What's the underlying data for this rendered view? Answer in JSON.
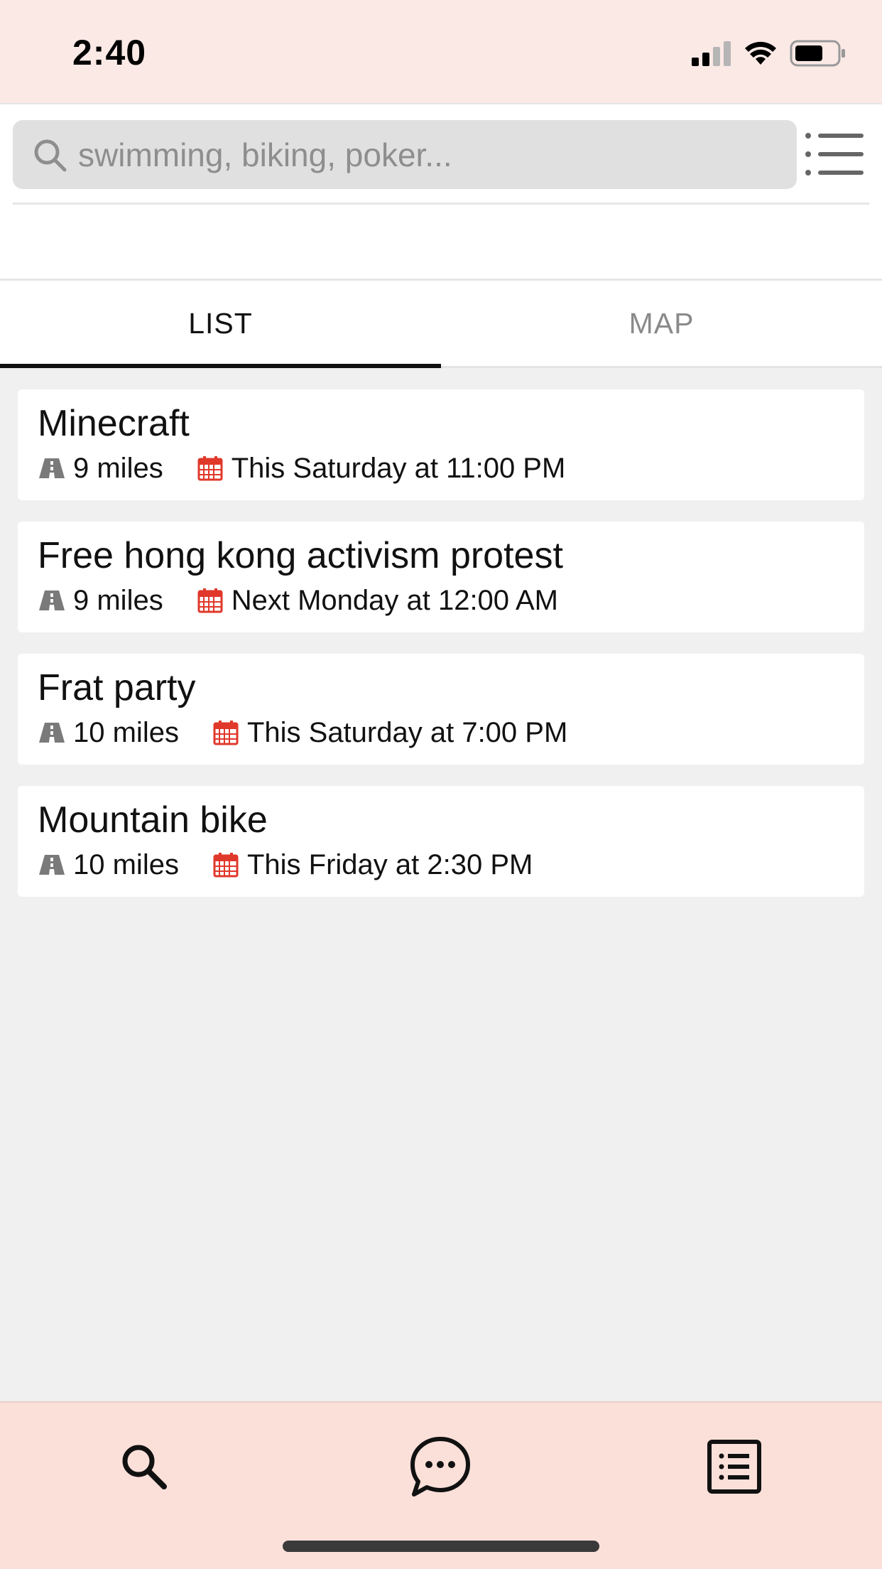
{
  "status": {
    "time": "2:40"
  },
  "search": {
    "placeholder": "swimming, biking, poker..."
  },
  "tabs": [
    {
      "label": "LIST",
      "active": true
    },
    {
      "label": "MAP",
      "active": false
    }
  ],
  "events": [
    {
      "title": "Minecraft",
      "distance": "9 miles",
      "date": "This Saturday at 11:00 PM"
    },
    {
      "title": "Free hong kong activism protest",
      "distance": "9 miles",
      "date": "Next Monday at 12:00 AM"
    },
    {
      "title": "Frat party",
      "distance": "10 miles",
      "date": "This Saturday at 7:00 PM"
    },
    {
      "title": "Mountain bike",
      "distance": "10 miles",
      "date": "This Friday at 2:30 PM"
    }
  ],
  "icons": {
    "search": "search-icon",
    "menu": "list-menu-icon",
    "distance": "road-icon",
    "date": "calendar-icon",
    "nav": [
      "search-icon",
      "chat-bubble-icon",
      "list-document-icon"
    ]
  },
  "colors": {
    "status_bar_bg": "#fbe9e6",
    "bottom_bar_bg": "#fbe0d9",
    "calendar_red": "#e0382b",
    "road_gray": "#7a7a7a"
  }
}
